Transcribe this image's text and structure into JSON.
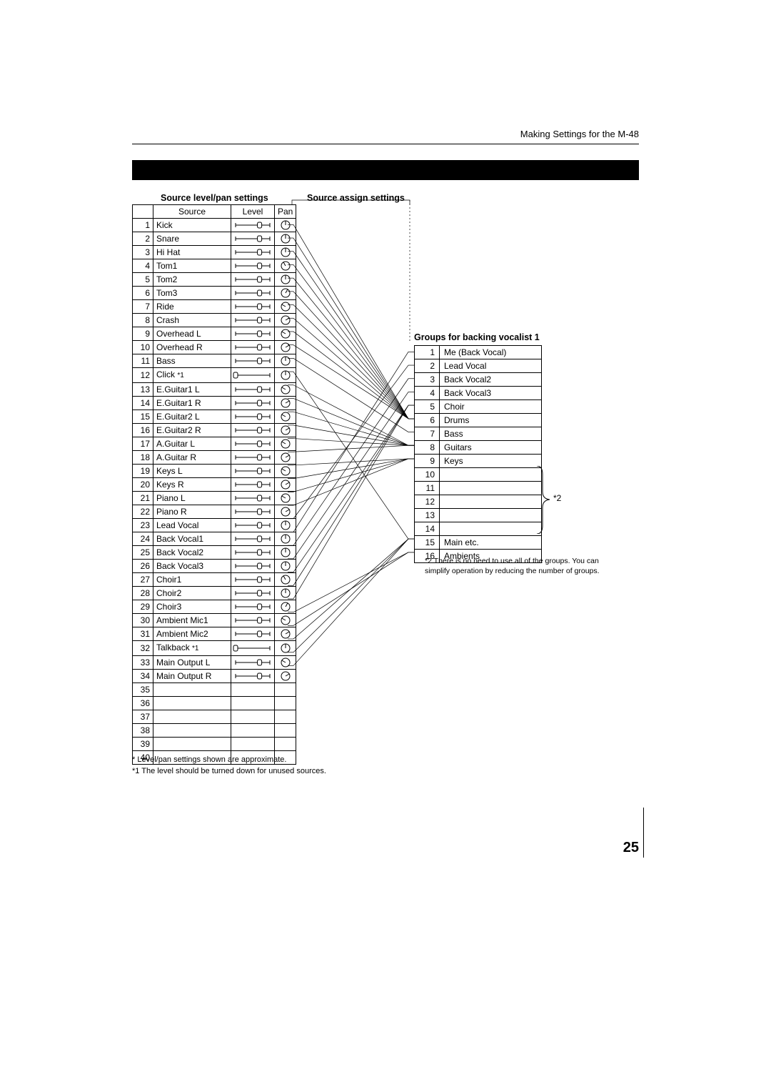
{
  "running_head": "Making Settings for the M-48",
  "labels": {
    "source_level_pan": "Source level/pan settings",
    "source_assign": "Source assign settings",
    "groups_title": "Groups for backing vocalist 1"
  },
  "src_header": {
    "source": "Source",
    "level": "Level",
    "pan": "Pan"
  },
  "sources": [
    {
      "n": 1,
      "name": "Kick",
      "note": "",
      "level": 0.7,
      "pan": "C"
    },
    {
      "n": 2,
      "name": "Snare",
      "note": "",
      "level": 0.7,
      "pan": "C"
    },
    {
      "n": 3,
      "name": "Hi Hat",
      "note": "",
      "level": 0.7,
      "pan": "C"
    },
    {
      "n": 4,
      "name": "Tom1",
      "note": "",
      "level": 0.7,
      "pan": "L-"
    },
    {
      "n": 5,
      "name": "Tom2",
      "note": "",
      "level": 0.7,
      "pan": "C"
    },
    {
      "n": 6,
      "name": "Tom3",
      "note": "",
      "level": 0.7,
      "pan": "R-"
    },
    {
      "n": 7,
      "name": "Ride",
      "note": "",
      "level": 0.7,
      "pan": "L"
    },
    {
      "n": 8,
      "name": "Crash",
      "note": "",
      "level": 0.7,
      "pan": "R"
    },
    {
      "n": 9,
      "name": "Overhead L",
      "note": "",
      "level": 0.7,
      "pan": "L"
    },
    {
      "n": 10,
      "name": "Overhead R",
      "note": "",
      "level": 0.7,
      "pan": "R"
    },
    {
      "n": 11,
      "name": "Bass",
      "note": "",
      "level": 0.7,
      "pan": "C"
    },
    {
      "n": 12,
      "name": "Click",
      "note": "*1",
      "level": 0.0,
      "pan": "C"
    },
    {
      "n": 13,
      "name": "E.Guitar1 L",
      "note": "",
      "level": 0.7,
      "pan": "L"
    },
    {
      "n": 14,
      "name": "E.Guitar1 R",
      "note": "",
      "level": 0.7,
      "pan": "R"
    },
    {
      "n": 15,
      "name": "E.Guitar2 L",
      "note": "",
      "level": 0.7,
      "pan": "L"
    },
    {
      "n": 16,
      "name": "E.Guitar2 R",
      "note": "",
      "level": 0.7,
      "pan": "R"
    },
    {
      "n": 17,
      "name": "A.Guitar L",
      "note": "",
      "level": 0.7,
      "pan": "L"
    },
    {
      "n": 18,
      "name": "A.Guitar R",
      "note": "",
      "level": 0.7,
      "pan": "R"
    },
    {
      "n": 19,
      "name": "Keys L",
      "note": "",
      "level": 0.7,
      "pan": "L"
    },
    {
      "n": 20,
      "name": "Keys R",
      "note": "",
      "level": 0.7,
      "pan": "R"
    },
    {
      "n": 21,
      "name": "Piano L",
      "note": "",
      "level": 0.7,
      "pan": "L"
    },
    {
      "n": 22,
      "name": "Piano R",
      "note": "",
      "level": 0.7,
      "pan": "R"
    },
    {
      "n": 23,
      "name": "Lead Vocal",
      "note": "",
      "level": 0.7,
      "pan": "C"
    },
    {
      "n": 24,
      "name": "Back Vocal1",
      "note": "",
      "level": 0.7,
      "pan": "C"
    },
    {
      "n": 25,
      "name": "Back Vocal2",
      "note": "",
      "level": 0.7,
      "pan": "C"
    },
    {
      "n": 26,
      "name": "Back Vocal3",
      "note": "",
      "level": 0.7,
      "pan": "C"
    },
    {
      "n": 27,
      "name": "Choir1",
      "note": "",
      "level": 0.7,
      "pan": "L-"
    },
    {
      "n": 28,
      "name": "Choir2",
      "note": "",
      "level": 0.7,
      "pan": "C"
    },
    {
      "n": 29,
      "name": "Choir3",
      "note": "",
      "level": 0.7,
      "pan": "R-"
    },
    {
      "n": 30,
      "name": "Ambient Mic1",
      "note": "",
      "level": 0.7,
      "pan": "L"
    },
    {
      "n": 31,
      "name": "Ambient Mic2",
      "note": "",
      "level": 0.7,
      "pan": "R"
    },
    {
      "n": 32,
      "name": "Talkback",
      "note": "*1",
      "level": 0.0,
      "pan": "C"
    },
    {
      "n": 33,
      "name": "Main Output L",
      "note": "",
      "level": 0.7,
      "pan": "L"
    },
    {
      "n": 34,
      "name": "Main Output R",
      "note": "",
      "level": 0.7,
      "pan": "R"
    },
    {
      "n": 35,
      "name": "",
      "note": "",
      "level": null,
      "pan": null
    },
    {
      "n": 36,
      "name": "",
      "note": "",
      "level": null,
      "pan": null
    },
    {
      "n": 37,
      "name": "",
      "note": "",
      "level": null,
      "pan": null
    },
    {
      "n": 38,
      "name": "",
      "note": "",
      "level": null,
      "pan": null
    },
    {
      "n": 39,
      "name": "",
      "note": "",
      "level": null,
      "pan": null
    },
    {
      "n": 40,
      "name": "",
      "note": "",
      "level": null,
      "pan": null
    }
  ],
  "groups": [
    {
      "n": 1,
      "name": "Me (Back Vocal)"
    },
    {
      "n": 2,
      "name": "Lead Vocal"
    },
    {
      "n": 3,
      "name": "Back Vocal2"
    },
    {
      "n": 4,
      "name": "Back Vocal3"
    },
    {
      "n": 5,
      "name": "Choir"
    },
    {
      "n": 6,
      "name": "Drums"
    },
    {
      "n": 7,
      "name": "Bass"
    },
    {
      "n": 8,
      "name": "Guitars"
    },
    {
      "n": 9,
      "name": "Keys"
    },
    {
      "n": 10,
      "name": ""
    },
    {
      "n": 11,
      "name": ""
    },
    {
      "n": 12,
      "name": ""
    },
    {
      "n": 13,
      "name": ""
    },
    {
      "n": 14,
      "name": ""
    },
    {
      "n": 15,
      "name": "Main etc."
    },
    {
      "n": 16,
      "name": "Ambients"
    }
  ],
  "assignments": [
    [
      1,
      6
    ],
    [
      2,
      6
    ],
    [
      3,
      6
    ],
    [
      4,
      6
    ],
    [
      5,
      6
    ],
    [
      6,
      6
    ],
    [
      7,
      6
    ],
    [
      8,
      6
    ],
    [
      9,
      6
    ],
    [
      10,
      6
    ],
    [
      11,
      7
    ],
    [
      12,
      15
    ],
    [
      13,
      8
    ],
    [
      14,
      8
    ],
    [
      15,
      8
    ],
    [
      16,
      8
    ],
    [
      17,
      8
    ],
    [
      18,
      8
    ],
    [
      19,
      9
    ],
    [
      20,
      9
    ],
    [
      21,
      9
    ],
    [
      22,
      9
    ],
    [
      23,
      2
    ],
    [
      24,
      1
    ],
    [
      25,
      3
    ],
    [
      26,
      4
    ],
    [
      27,
      5
    ],
    [
      28,
      5
    ],
    [
      29,
      5
    ],
    [
      30,
      16
    ],
    [
      31,
      16
    ],
    [
      32,
      15
    ],
    [
      33,
      15
    ],
    [
      34,
      15
    ]
  ],
  "star2_brace_rows": [
    10,
    14
  ],
  "star2_mark": "*2",
  "grp_note": "*2  There is no need to use all of the groups. You can simplify operation by reducing the number of groups.",
  "src_notes": [
    "* Level/pan settings shown are approximate.",
    "*1 The level should be turned down for unused sources."
  ],
  "page_number": "25"
}
